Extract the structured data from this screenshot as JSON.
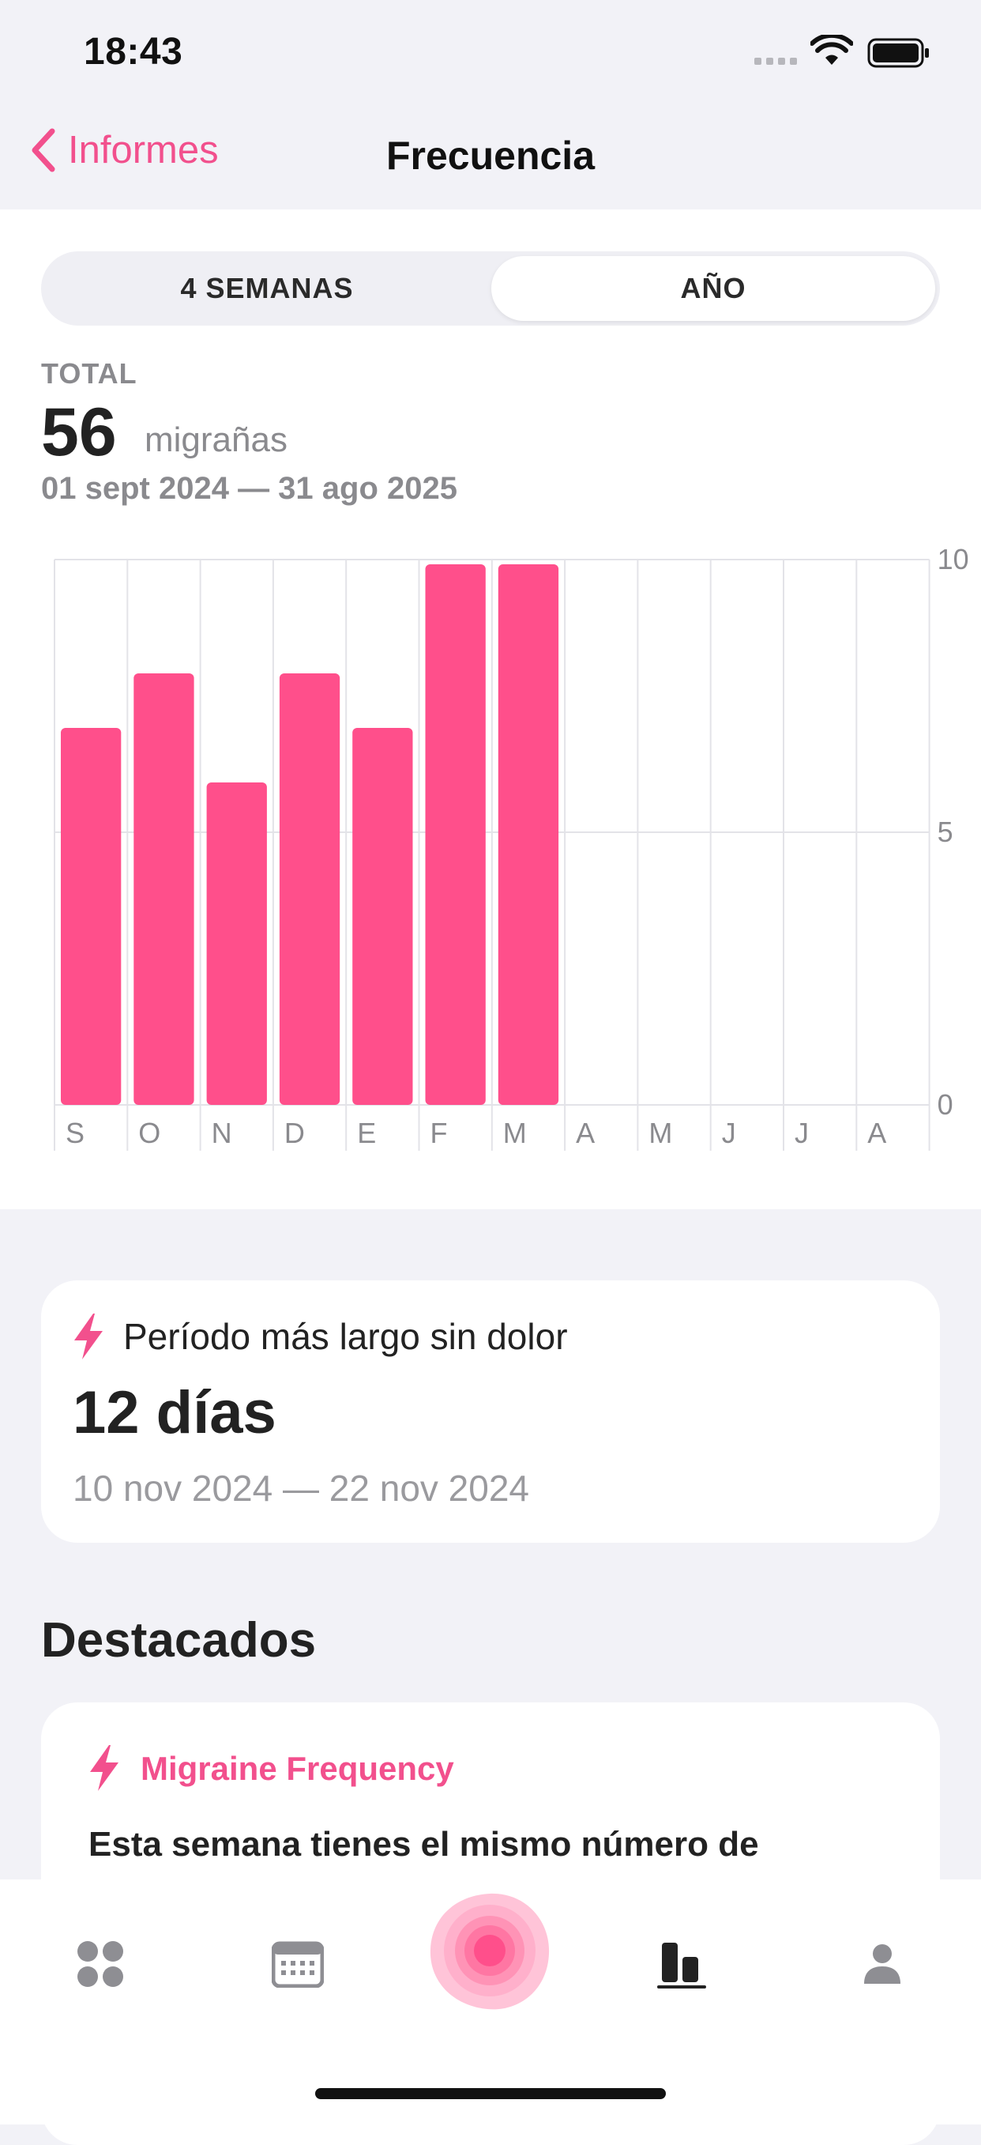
{
  "status_bar": {
    "time": "18:43"
  },
  "nav": {
    "back_label": "Informes",
    "title": "Frecuencia"
  },
  "segmented": {
    "option_1": "4 SEMANAS",
    "option_2": "AÑO",
    "selected": "AÑO"
  },
  "summary": {
    "total_label": "TOTAL",
    "total_value": "56",
    "total_unit": "migrañas",
    "date_range": "01 sept 2024 — 31 ago 2025"
  },
  "colors": {
    "accent": "#f2508d",
    "bar": "#ff4f8b",
    "background": "#f2f2f7"
  },
  "chart_data": {
    "type": "bar",
    "categories": [
      "S",
      "O",
      "N",
      "D",
      "E",
      "F",
      "M",
      "A",
      "M",
      "J",
      "J",
      "A"
    ],
    "values": [
      7,
      8,
      6,
      8,
      7,
      10,
      10,
      0,
      0,
      0,
      0,
      0
    ],
    "y_ticks": [
      "0",
      "5",
      "10"
    ],
    "ylim": [
      0,
      10
    ],
    "grid": true
  },
  "streak": {
    "title": "Período más largo sin dolor",
    "value": "12 días",
    "range": "10 nov 2024 — 22 nov 2024",
    "icon": "bolt-icon"
  },
  "highlights": {
    "section_title": "Destacados",
    "card_title": "Migraine Frequency",
    "card_text": "Esta semana tienes el mismo número de",
    "icon": "bolt-icon"
  },
  "tabbar": {
    "items": [
      "dashboard-icon",
      "calendar-icon",
      "record-icon",
      "reports-icon",
      "profile-icon"
    ],
    "selected": "reports-icon"
  }
}
